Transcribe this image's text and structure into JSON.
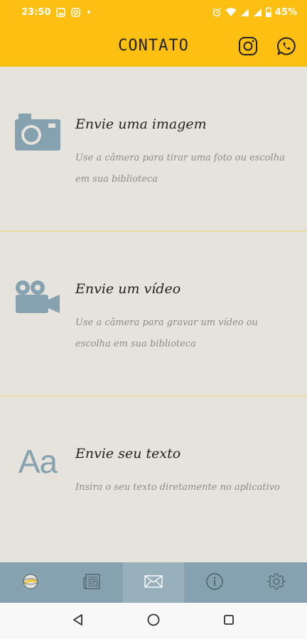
{
  "status_bar": {
    "time": "23:50",
    "battery": "45%",
    "left_icons": [
      "image-icon",
      "instagram-icon",
      "dot-icon"
    ],
    "right_icons": [
      "alarm-icon",
      "wifi-icon",
      "signal-icon",
      "signal-icon",
      "battery-icon"
    ]
  },
  "header": {
    "title": "CONTATO",
    "icons": [
      "instagram-icon",
      "whatsapp-icon"
    ]
  },
  "options": [
    {
      "title": "Envie uma imagem",
      "description": "Use a câmera para tirar uma foto ou escolha em sua biblioteca",
      "icon": "camera-icon"
    },
    {
      "title": "Envie um vídeo",
      "description": "Use a câmera para gravar um vídeo ou escolha em sua biblioteca",
      "icon": "video-camera-icon"
    },
    {
      "title": "Envie seu texto",
      "description": "Insira o seu texto diretamente no aplicativo",
      "icon_text": "Aa"
    }
  ],
  "bottom_nav": {
    "items": [
      "globe-icon",
      "newspaper-icon",
      "mail-icon",
      "info-icon",
      "settings-icon"
    ],
    "active_index": 2
  },
  "system_nav": [
    "back-icon",
    "home-icon",
    "recents-icon"
  ],
  "colors": {
    "accent": "#fdbf12",
    "background": "#e6e3dc",
    "nav_bar": "#86a2b0",
    "icon": "#86a2b0",
    "divider": "#f3d27a"
  }
}
